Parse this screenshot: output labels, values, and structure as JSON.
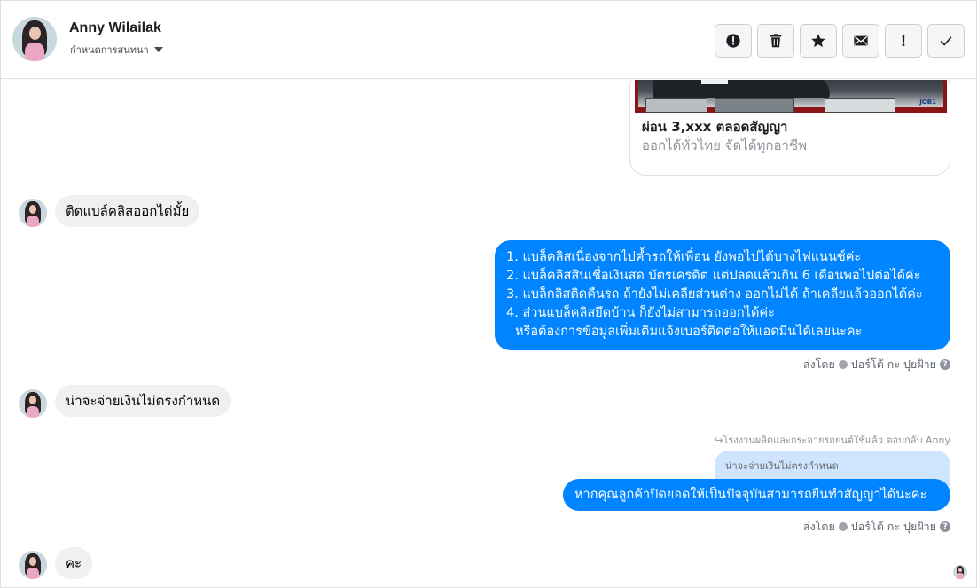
{
  "header": {
    "contact_name": "Anny Wilailak",
    "subtitle": "กำหนดการสนทนา",
    "toolbar": [
      {
        "name": "mark-spam-button",
        "icon": "alert-circle-icon"
      },
      {
        "name": "delete-button",
        "icon": "trash-icon"
      },
      {
        "name": "star-button",
        "icon": "star-icon"
      },
      {
        "name": "mark-unread-button",
        "icon": "envelope-icon"
      },
      {
        "name": "follow-up-button",
        "icon": "exclamation-icon"
      },
      {
        "name": "mark-done-button",
        "icon": "checkmark-icon"
      }
    ]
  },
  "ad_card": {
    "title": "ผ่อน 3,xxx ตลอดสัญญา",
    "subtitle": "ออกได้ทั่วไทย จัดได้ทุกอาชีพ",
    "image_logo": "JOB1"
  },
  "messages": {
    "m1": "ติดแบล์คลิสออกได่มั้ย",
    "m2_lines": [
      "1. แบล็คลิสเนื่องจากไปค้ำรถให้เพื่อน ยังพอไปได้บางไฟแนนซ์ค่ะ",
      "2. แบล็คลิสสินเชื่อเงินสด บัตรเครดิต แต่ปลดแล้วเกิน 6 เดือนพอไปต่อได้ค่ะ",
      "3. แบล็กลิสติดคืนรถ ถ้ายังไม่เคลียส่วนต่าง ออกไม่ได้ ถ้าเคลียแล้วออกได้ค่ะ",
      "4. ส่วนแบล็คลิสยึดบ้าน ก็ยังไม่สามารถออกได้ค่ะ",
      "หรือต้องการข้อมูลเพิ่มเติมแจ้งเบอร์ติดต่อให้แอดมินได้เลยนะคะ"
    ],
    "sent_by_1": "ส่งโดย",
    "sender_1": "ปอร์โต้ กะ ปุยฝ้าย",
    "m3": "น่าจะจ่ายเงินไม่ตรงกำหนด",
    "reply_note": "โรงงานผลิตและกระจายรถยนต์ใช้แล้ว ตอบกลับ Anny",
    "quoted": "น่าจะจ่ายเงินไม่ตรงกำหนด",
    "m4": "หากคุณลูกค้าปิดยอดให้เป็นปัจจุบันสามารถยื่นทำสัญญาได้นะคะ",
    "sent_by_2": "ส่งโดย",
    "sender_2": "ปอร์โต้ กะ ปุยฝ้าย",
    "m5": "คะ"
  },
  "colors": {
    "outgoing_bubble": "#0084ff",
    "incoming_bubble": "#f0f0f0",
    "quote_bubble": "#cfe5ff"
  }
}
